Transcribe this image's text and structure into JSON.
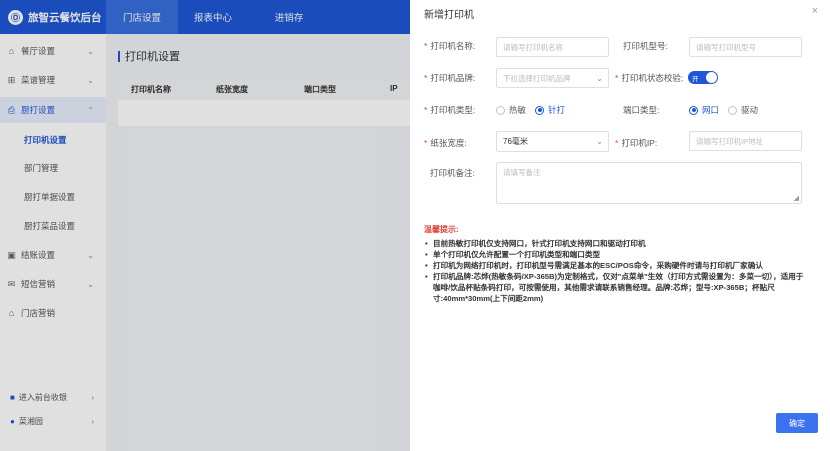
{
  "app": {
    "title": "旅智云餐饮后台",
    "logo_glyph": "Ⓞ"
  },
  "topnav": [
    "门店设置",
    "报表中心",
    "进销存"
  ],
  "sidebar": {
    "items": [
      {
        "label": "餐厅设置",
        "icon": "home-icon",
        "glyph": "⌂"
      },
      {
        "label": "菜谱管理",
        "icon": "grid-icon",
        "glyph": "⊞"
      },
      {
        "label": "厨打设置",
        "icon": "printer-icon",
        "glyph": "⎙"
      }
    ],
    "sub": [
      "打印机设置",
      "部门管理",
      "厨打单据设置",
      "厨打菜品设置"
    ],
    "items2": [
      {
        "label": "结账设置",
        "icon": "checkout-icon",
        "glyph": "▣"
      },
      {
        "label": "短信营销",
        "icon": "mail-icon",
        "glyph": "✉"
      },
      {
        "label": "门店营销",
        "icon": "shop-icon",
        "glyph": "⌂"
      }
    ],
    "bottom": [
      {
        "label": "进入前台收银",
        "icon": "cashier-icon",
        "glyph": "■"
      },
      {
        "label": "菜湘园",
        "icon": "location-icon",
        "glyph": "●"
      }
    ]
  },
  "main": {
    "title": "打印机设置",
    "columns": [
      "打印机名称",
      "纸张宽度",
      "端口类型",
      "IP"
    ]
  },
  "drawer": {
    "title": "新增打印机",
    "close_glyph": "×",
    "fields": {
      "name": {
        "label": "打印机名称:",
        "placeholder": "请输写打印机名称"
      },
      "model": {
        "label": "打印机型号:",
        "placeholder": "请输写打印机型号"
      },
      "brand": {
        "label": "打印机品牌:",
        "placeholder": "下拉选择打印机品牌"
      },
      "status_check": {
        "label": "打印机状态校验:",
        "toggle_text": "开",
        "on": true
      },
      "type": {
        "label": "打印机类型:",
        "options": [
          "热敏",
          "针打"
        ],
        "selected": "针打"
      },
      "port": {
        "label": "端口类型:",
        "options": [
          "网口",
          "驱动"
        ],
        "selected": "网口"
      },
      "paper": {
        "label": "纸张宽度:",
        "value": "76毫米"
      },
      "ip": {
        "label": "打印机IP:",
        "placeholder": "请输写打印机IP地址"
      },
      "remark": {
        "label": "打印机备注:",
        "placeholder": "请填写备注"
      }
    },
    "tips_title": "温馨提示:",
    "tips": [
      "目前热敏打印机仅支持网口，针式打印机支持网口和驱动打印机",
      "单个打印机仅允许配置一个打印机类型和端口类型",
      "打印机为网络打印机时，打印机型号需满足基本的ESC/POS命令，采购硬件时请与打印机厂家确认",
      "打印机品牌:芯烨(热敏条码/XP-365B)为定制格式，仅对\"点菜单\"生效（打印方式需设置为：多菜一切），适用于咖啡/饮品杯贴条码打印，可按需使用，其他需求请联系销售经理。品牌:芯烨；型号:XP-365B；杯贴尺寸:40mm*30mm(上下间距2mm)"
    ],
    "confirm": "确定"
  }
}
